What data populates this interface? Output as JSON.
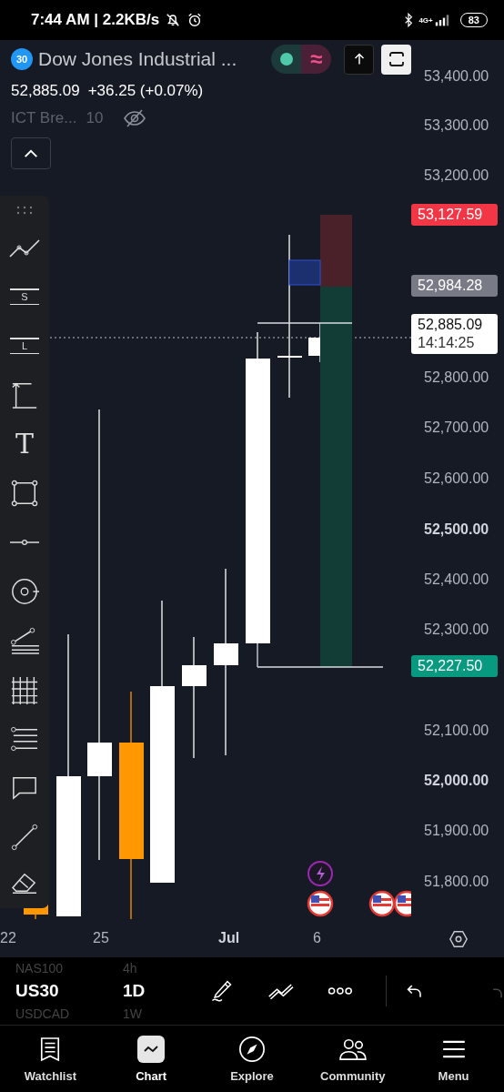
{
  "status_bar": {
    "time": "7:44 AM | 2.2KB/s",
    "network": "4G+",
    "battery": "83"
  },
  "header": {
    "badge": "30",
    "title": "Dow Jones Industrial ...",
    "wave": "≈",
    "price": "52,885.09",
    "change": "+36.25 (+0.07%)",
    "indicator": {
      "name": "ICT Bre...",
      "value": "10"
    }
  },
  "toolbar": {
    "items": [
      {
        "kind": "grip"
      },
      {
        "kind": "trend"
      },
      {
        "kind": "lines",
        "letter": "S"
      },
      {
        "kind": "lines",
        "letter": "L"
      },
      {
        "kind": "measure"
      },
      {
        "kind": "text",
        "letter": "T"
      },
      {
        "kind": "rect"
      },
      {
        "kind": "segment"
      },
      {
        "kind": "circle"
      },
      {
        "kind": "fork"
      },
      {
        "kind": "grid"
      },
      {
        "kind": "fib"
      },
      {
        "kind": "note"
      },
      {
        "kind": "line"
      },
      {
        "kind": "eraser"
      }
    ]
  },
  "price_axis": [
    {
      "label": "53,400.00",
      "major": false
    },
    {
      "label": "53,300.00",
      "major": false
    },
    {
      "label": "53,200.00",
      "major": false
    },
    {
      "label": "52,800.00",
      "major": false
    },
    {
      "label": "52,700.00",
      "major": false
    },
    {
      "label": "52,600.00",
      "major": false
    },
    {
      "label": "52,500.00",
      "major": true
    },
    {
      "label": "52,400.00",
      "major": false
    },
    {
      "label": "52,300.00",
      "major": false
    },
    {
      "label": "52,100.00",
      "major": false
    },
    {
      "label": "52,000.00",
      "major": true
    },
    {
      "label": "51,900.00",
      "major": false
    },
    {
      "label": "51,800.00",
      "major": false
    }
  ],
  "price_badges": [
    {
      "label": "53,127.59",
      "color": "#f23645"
    },
    {
      "label": "52,984.28",
      "color": "#787b86"
    },
    {
      "label": "52,885.09",
      "sub": "14:14:25",
      "color": "#ffffff"
    },
    {
      "label": "52,227.50",
      "color": "#089981"
    }
  ],
  "date_axis": [
    {
      "label": "22",
      "major": false
    },
    {
      "label": "25",
      "major": false
    },
    {
      "label": "Jul",
      "major": true
    },
    {
      "label": "6",
      "major": false
    }
  ],
  "trade_bar": {
    "symbols": [
      {
        "symbol": "NAS100",
        "interval": "4h",
        "selected": false
      },
      {
        "symbol": "US30",
        "interval": "1D",
        "selected": true
      },
      {
        "symbol": "USDCAD",
        "interval": "1W",
        "selected": false
      }
    ]
  },
  "tabs": [
    {
      "label": "Watchlist",
      "selected": false
    },
    {
      "label": "Chart",
      "selected": true
    },
    {
      "label": "Explore",
      "selected": false
    },
    {
      "label": "Community",
      "selected": false
    },
    {
      "label": "Menu",
      "selected": false
    }
  ]
}
